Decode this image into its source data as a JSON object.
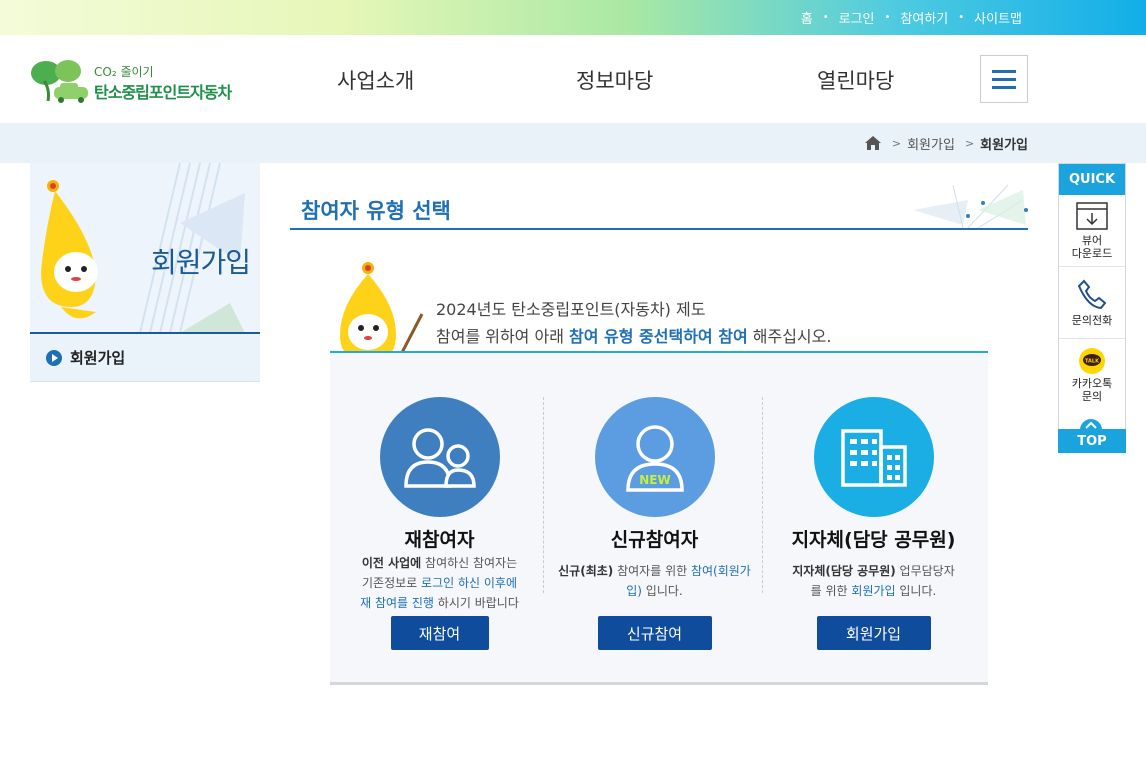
{
  "topbar": {
    "links": [
      {
        "label": "홈"
      },
      {
        "label": "로그인"
      },
      {
        "label": "참여하기"
      },
      {
        "label": "사이트맵"
      }
    ]
  },
  "header": {
    "logo_small": "CO₂ 줄이기",
    "logo_big": "탄소중립포인트자동차",
    "nav": [
      {
        "label": "사업소개"
      },
      {
        "label": "정보마당"
      },
      {
        "label": "열린마당"
      }
    ],
    "menu_icon": "hamburger-icon"
  },
  "breadcrumb": {
    "home_icon": "home-icon",
    "items": [
      "회원가입",
      "회원가입"
    ]
  },
  "sidebar": {
    "title": "회원가입",
    "menu": [
      {
        "label": "회원가입"
      }
    ]
  },
  "main": {
    "title": "참여자 유형 선택",
    "intro_line1": "2024년도 탄소중립포인트(자동차) 제도",
    "intro_line2_a": "참여를 위하여 아래 ",
    "intro_line2_hl": "참여 유형 중선택하여 참여",
    "intro_line2_b": " 해주십시오.",
    "options": [
      {
        "title": "재참여자",
        "desc_bold": "이전 사업에",
        "desc_1": " 참여하신 참여자는",
        "desc_2": "기존정보로 ",
        "desc_blue_1": "로그인 하신 이후에",
        "desc_blue_2": "재 참여를 진행",
        "desc_3": " 하시기 바랍니다",
        "button": "재참여",
        "color": "#3f7fc0",
        "icon": "users-icon"
      },
      {
        "title": "신규참여자",
        "desc_bold": "신규(최초)",
        "desc_1": " 참여자를 위한 ",
        "desc_blue_1": "참여(회원가입)",
        "desc_2": " 입니다.",
        "button": "신규참여",
        "color": "#5b9de0",
        "icon": "new-user-icon",
        "badge": "NEW"
      },
      {
        "title": "지자체(담당 공무원)",
        "desc_bold": "지자체(담당 공무원)",
        "desc_1": " 업무담당자",
        "desc_2": "를 위한 ",
        "desc_blue_1": "회원가입",
        "desc_3": " 입니다.",
        "button": "회원가입",
        "color": "#1aaee4",
        "icon": "building-icon"
      }
    ]
  },
  "quick": {
    "title": "QUICK",
    "items": [
      {
        "label1": "뷰어",
        "label2": "다운로드",
        "icon": "download-icon"
      },
      {
        "label1": "문의전화",
        "label2": "",
        "icon": "phone-icon"
      },
      {
        "label1": "카카오톡",
        "label2": "문의",
        "icon": "kakaotalk-icon",
        "badge": "TALK"
      }
    ],
    "top": "TOP"
  },
  "colors": {
    "primary": "#1f6fb5",
    "button": "#0f4c9c",
    "accent": "#1aa3dd",
    "panel_bg": "#f5f7fa"
  }
}
